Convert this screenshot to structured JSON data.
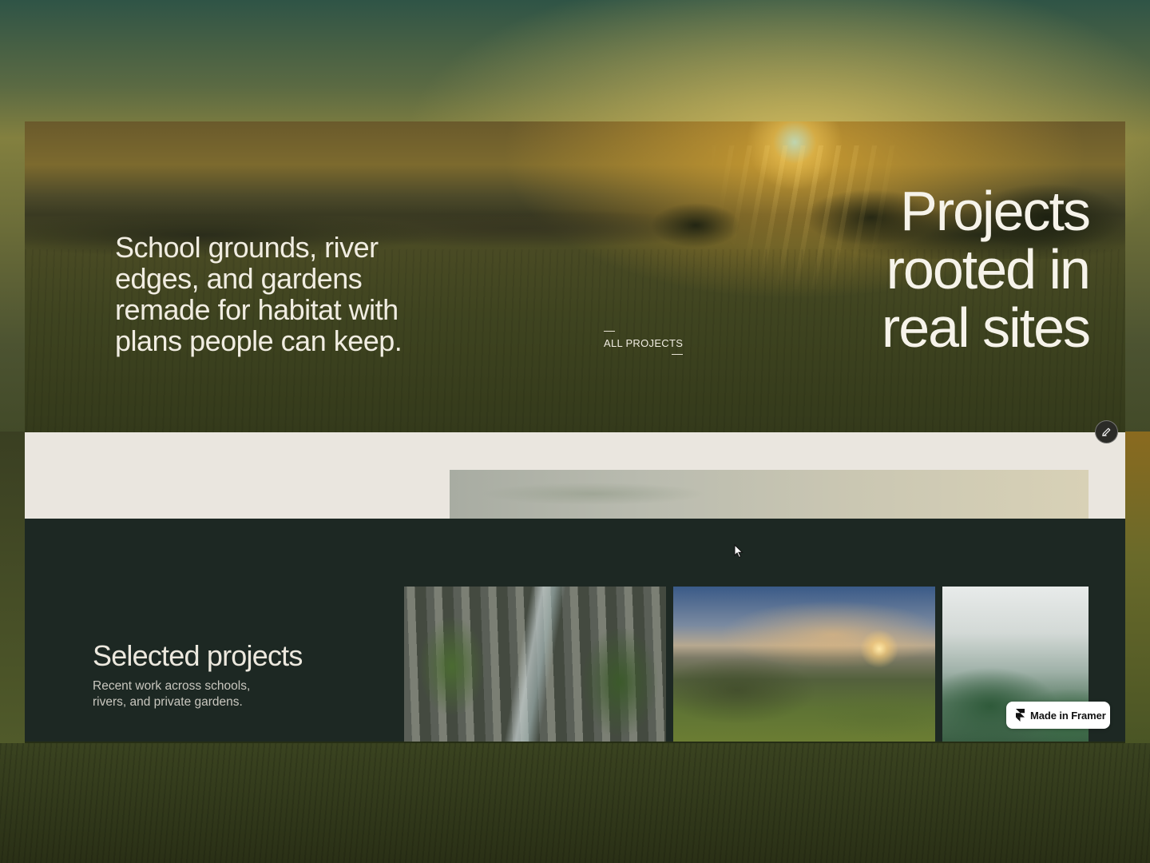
{
  "hero": {
    "intro": "School grounds, river edges, and gardens remade for habitat with plans people can keep.",
    "cta_label": "ALL PROJECTS",
    "title_line1": "Projects",
    "title_line2": "rooted in",
    "title_line3": "real sites"
  },
  "selected": {
    "title": "Selected projects",
    "description": "Recent work across schools, rivers, and private gardens."
  },
  "badge": {
    "label": "Made in Framer"
  },
  "colors": {
    "dark_section": "#1d2823",
    "band": "#eae6df",
    "hero_text": "#f6f3ea"
  },
  "icons": {
    "edit": "pencil-icon",
    "framer": "framer-logo-icon",
    "cursor": "mouse-cursor-icon"
  }
}
